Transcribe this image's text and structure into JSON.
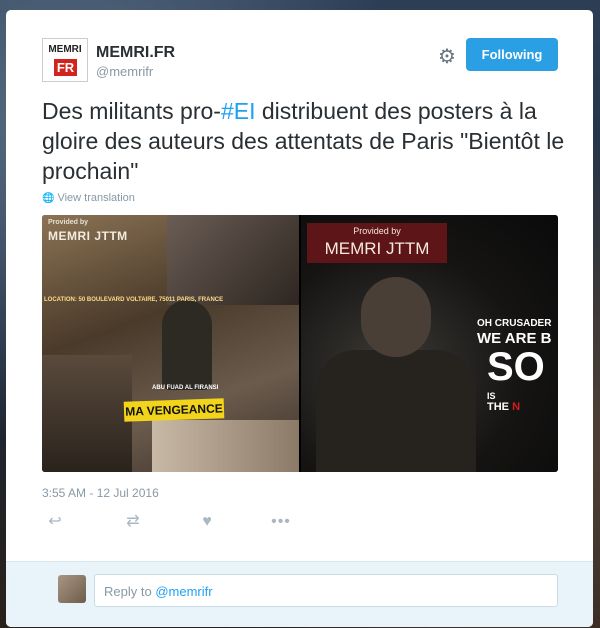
{
  "account": {
    "avatar_top": "MEMRI",
    "avatar_badge": "FR",
    "name": "MEMRI.FR",
    "handle": "@memrifr"
  },
  "header": {
    "follow_label": "Following",
    "gear_icon": "gear-icon"
  },
  "tweet": {
    "text_before": "Des militants pro-",
    "hashtag": "#EI",
    "text_after": " distribuent des posters à la gloire des auteurs des attentats de Paris \"Bientôt le prochain\"",
    "translate_label": "View translation",
    "timestamp": "3:55 AM - 12 Jul 2016"
  },
  "media": {
    "left": {
      "provided_by": "Provided by",
      "brand": "MEMRI JTTM",
      "location": "LOCATION: 50 BOULEVARD VOLTAIRE, 75011 PARIS, FRANCE",
      "name_caption": "ABU FUAD AL FIRANSI",
      "banner": "MA VENGEANCE"
    },
    "right": {
      "provided_by": "Provided by",
      "brand": "MEMRI JTTM",
      "line1": "OH CRUSADER",
      "line2": "WE ARE B",
      "line3": "SO",
      "line4": "IS",
      "line5a": "THE ",
      "line5b": "N"
    }
  },
  "actions": {
    "reply_icon": "reply-icon",
    "retweet_icon": "retweet-icon",
    "like_icon": "heart-icon",
    "more_icon": "more-icon"
  },
  "reply": {
    "prefix": "Reply to ",
    "mention": "@memrifr"
  },
  "colors": {
    "accent": "#2b9fe3",
    "link": "#1da1f2",
    "text": "#292f33",
    "muted": "#8899a6",
    "badge_red": "#d0241c"
  }
}
